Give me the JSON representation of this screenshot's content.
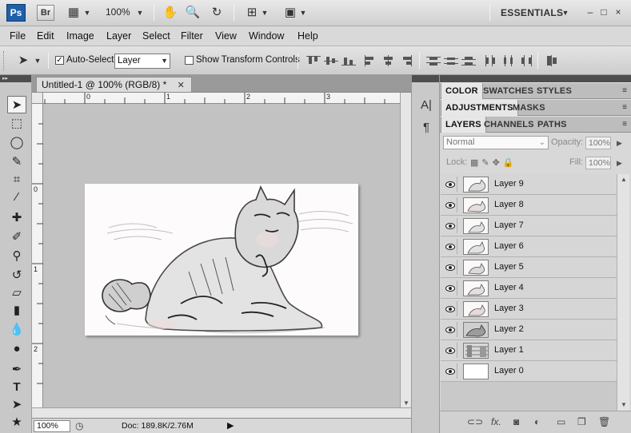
{
  "app": {
    "logo": "Ps",
    "bridge": "Br",
    "zoom": "100%",
    "workspace": "ESSENTIALS",
    "window_controls": [
      "–",
      "□",
      "×"
    ]
  },
  "menu": [
    "File",
    "Edit",
    "Image",
    "Layer",
    "Select",
    "Filter",
    "View",
    "Window",
    "Help"
  ],
  "options": {
    "auto_select_label": "Auto-Select:",
    "auto_select_checked": true,
    "auto_select_value": "Layer",
    "transform_controls_label": "Show Transform Controls",
    "transform_controls_checked": false
  },
  "document": {
    "tab_title": "Untitled-1 @ 100% (RGB/8) *",
    "ruler_h": [
      "0",
      "1",
      "2",
      "3"
    ],
    "ruler_v": [
      "0",
      "1",
      "2"
    ],
    "status_zoom": "100%",
    "doc_size": "Doc: 189.8K/2.76M"
  },
  "panels": {
    "group1": [
      "COLOR",
      "SWATCHES",
      "STYLES"
    ],
    "group2": [
      "ADJUSTMENTS",
      "MASKS"
    ],
    "group3": [
      "LAYERS",
      "CHANNELS",
      "PATHS"
    ],
    "blend_mode": "Normal",
    "opacity_label": "Opacity:",
    "opacity_value": "100%",
    "lock_label": "Lock:",
    "fill_label": "Fill:",
    "fill_value": "100%"
  },
  "layers": [
    {
      "name": "Layer 9"
    },
    {
      "name": "Layer 8"
    },
    {
      "name": "Layer 7"
    },
    {
      "name": "Layer 6"
    },
    {
      "name": "Layer 5"
    },
    {
      "name": "Layer 4"
    },
    {
      "name": "Layer 3"
    },
    {
      "name": "Layer 2"
    },
    {
      "name": "Layer 1"
    },
    {
      "name": "Layer 0"
    }
  ]
}
